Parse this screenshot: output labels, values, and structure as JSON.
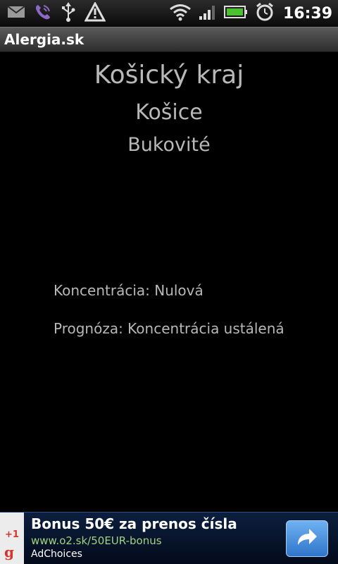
{
  "status_bar": {
    "time": "16:39",
    "icons": [
      "gmail-icon",
      "viber-icon",
      "usb-icon",
      "warning-icon",
      "wifi-icon",
      "signal-icon",
      "battery-icon",
      "alarm-icon"
    ]
  },
  "app": {
    "title": "Alergia.sk"
  },
  "main": {
    "region": "Košický kraj",
    "city": "Košice",
    "plant": "Bukovité",
    "concentration": "Koncentrácia: Nulová",
    "forecast": "Prognóza: Koncentrácia ustálená"
  },
  "ad": {
    "title": "Bonus 50€ za prenos čísla",
    "url": "www.o2.sk/50EUR-bonus",
    "choices": "AdChoices",
    "plus_one": "+1",
    "g_letter": "g",
    "accent_url_color": "#9fd480",
    "button_color": "#3a84d6"
  }
}
